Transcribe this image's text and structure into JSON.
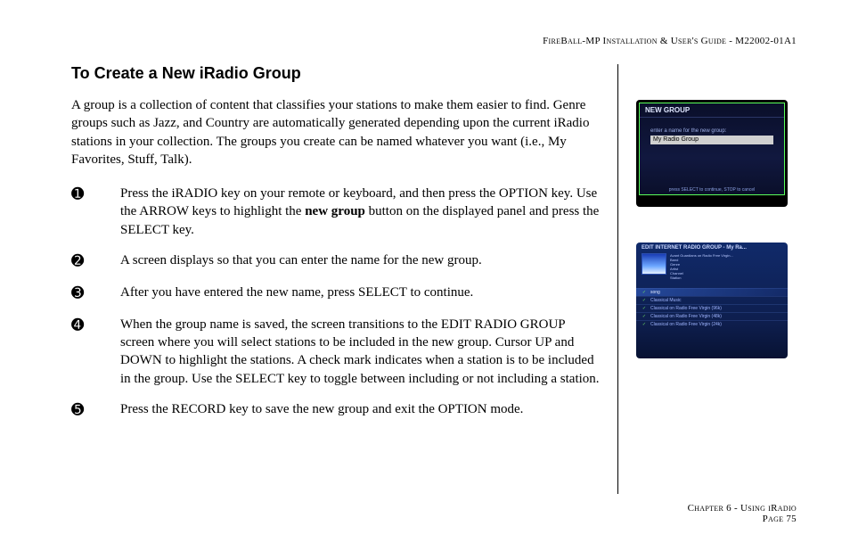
{
  "header": {
    "product": "FireBall-MP",
    "doc_title": "Installation & User's Guide",
    "doc_number": "M22002-01A1"
  },
  "title": "To Create a New iRadio Group",
  "intro": "A group is a collection of content that classifies your stations to make them easier to find. Genre groups such as Jazz, and Country are automatically generated depending upon the current iRadio stations in your collection.  The groups you create can be named whatever you want (i.e., My Favorites, Stuff, Talk).",
  "steps": [
    {
      "bullet": "➊",
      "text_pre": "Press the iRADIO key on your remote or keyboard, and then press the OPTION key. Use the ARROW keys to highlight the ",
      "bold": "new group",
      "text_post": " button on the displayed panel and press the SELECT key."
    },
    {
      "bullet": "➋",
      "text_pre": "A screen displays so that you can enter the name for the new group.",
      "bold": "",
      "text_post": ""
    },
    {
      "bullet": "➌",
      "text_pre": "After you have entered the new name, press SELECT to continue.",
      "bold": "",
      "text_post": ""
    },
    {
      "bullet": "➍",
      "text_pre": "When the group name is saved, the screen transitions to the EDIT RADIO GROUP screen where you will select stations to be included in the new group. Cursor UP and DOWN  to highlight the stations.  A check mark indicates when a station is to be included in the group. Use the SELECT key to toggle between including or not including a station.",
      "bold": "",
      "text_post": ""
    },
    {
      "bullet": "➎",
      "text_pre": "Press the RECORD key to save the new group and exit the OPTION mode.",
      "bold": "",
      "text_post": ""
    }
  ],
  "screenshot1": {
    "title": "NEW GROUP",
    "label": "enter a name for the new group:",
    "input_value": "My Radio Group",
    "hint": "press SELECT to continue, STOP to cancel"
  },
  "screenshot2": {
    "title": "EDIT INTERNET RADIO GROUP - My Ra...",
    "now_playing": "Avant Guardians on Radio Free Virgin...",
    "meta_rows": [
      "Band",
      "Genre",
      "Artist",
      "Channel",
      "Station"
    ],
    "list": [
      {
        "checked": true,
        "label": "song"
      },
      {
        "checked": true,
        "label": "Classical Music"
      },
      {
        "checked": true,
        "label": "Classical on Radio Free Virgin (96k)"
      },
      {
        "checked": true,
        "label": "Classical on Radio Free Virgin (48k)"
      },
      {
        "checked": true,
        "label": "Classical on Radio Free Virgin (24k)"
      }
    ]
  },
  "footer": {
    "chapter": "Chapter 6 - Using iRadio",
    "page": "Page 75"
  }
}
